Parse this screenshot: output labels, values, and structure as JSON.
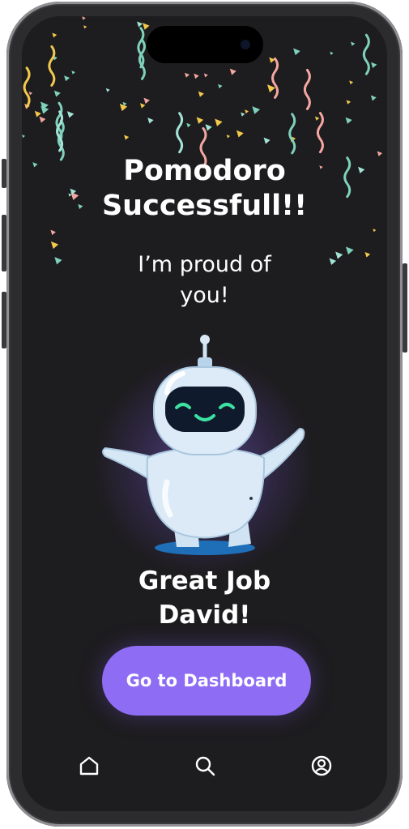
{
  "headline": {
    "line1": "Pomodoro",
    "line2": "Successfull!!"
  },
  "subtitle": {
    "line1": "I’m proud of",
    "line2": "you!"
  },
  "message": {
    "line1": "Great Job",
    "line2": "David!"
  },
  "cta": {
    "label": "Go to Dashboard"
  },
  "bottom_nav": {
    "items": [
      {
        "icon": "home-icon"
      },
      {
        "icon": "search-icon"
      },
      {
        "icon": "profile-icon"
      }
    ]
  },
  "colors": {
    "background": "#1d1c1e",
    "accent": "#8e6cf3",
    "text": "#ffffff",
    "confetti": [
      "#f2c94c",
      "#7fd1b9",
      "#f4a7a0",
      "#a3e4d7"
    ]
  }
}
